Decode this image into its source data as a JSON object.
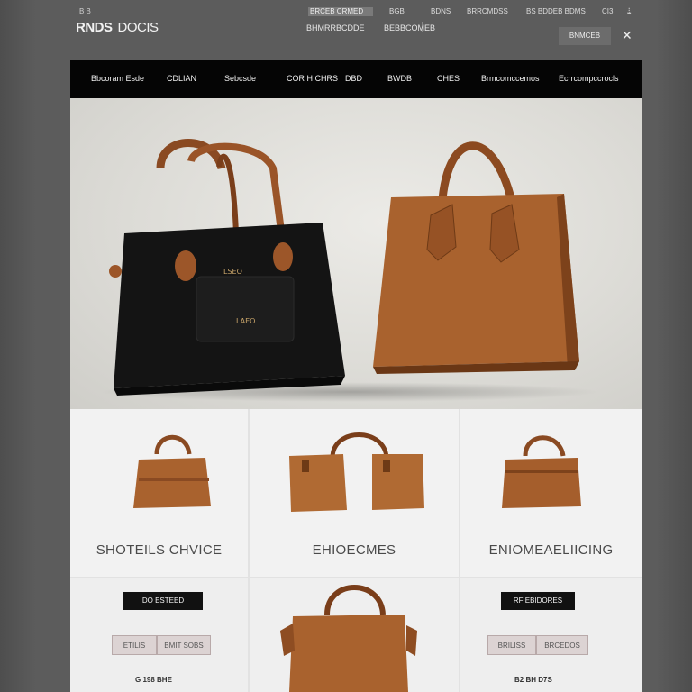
{
  "header": {
    "brand_top": "B B",
    "brand_main": "RNDS",
    "brand_second": "DOCIS",
    "search_text": "BRCEB CRMED",
    "util_links": [
      "BGB",
      "BDNS",
      "BRRCMDSS",
      "BS BDDEB BDMS",
      "CI3"
    ],
    "util_close": "⇣",
    "secondary_links": [
      "BHMRRBCDDE",
      "BEBBCOMEB"
    ],
    "login_label": "BNMCEB",
    "close_icon": "✕"
  },
  "nav": {
    "items": [
      "Bbcoram Esde",
      "CDLIAN",
      "Sebcsde",
      "COR H CHRS",
      "DBD",
      "BWDB",
      "CHES",
      "Brmcomccemos",
      "Ecrrcompccrocls"
    ]
  },
  "hero": {
    "black_bag_label_top": "LSEO",
    "black_bag_label_bottom": "LAEO"
  },
  "cards": [
    {
      "title": "SHOTEILS CHVICE"
    },
    {
      "title": "EHIOECMES"
    },
    {
      "title": "ENIOMEAELIICING"
    }
  ],
  "lower": {
    "left_button": "DO ESTEED",
    "left_pills": [
      "ETILIS",
      "BMIT SOBS"
    ],
    "left_price": "G 198 BHE",
    "right_button": "RF EBIDORES",
    "right_pills": [
      "BRILISS",
      "BRCEDOS"
    ],
    "right_price": "B2 BH D7S"
  },
  "colors": {
    "nav_bg": "#050505",
    "leather_tan": "#a9622e",
    "leather_black": "#161616"
  }
}
